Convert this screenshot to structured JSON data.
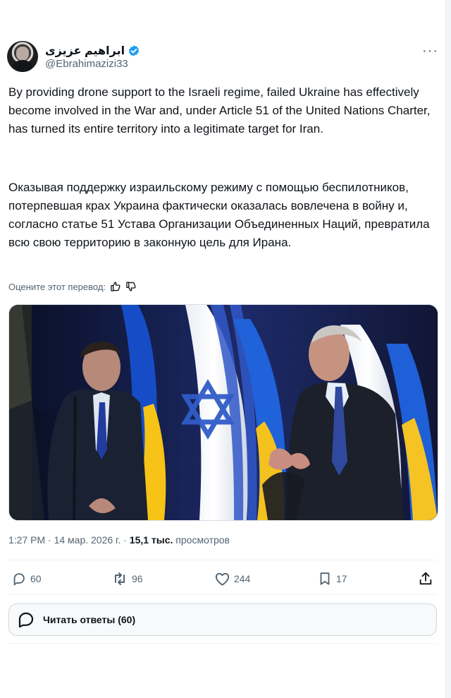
{
  "tweet": {
    "display_name": "ابراهیم عزیزی",
    "handle": "@Ebrahimazizi33",
    "more_label": "···",
    "text_en": "By providing drone support to the Israeli regime, failed Ukraine has effectively become involved in the War and, under Article 51 of the United Nations Charter, has turned its entire territory into a legitimate target for Iran.",
    "text_ru": "Оказывая поддержку израильскому режиму с помощью беспилотников, потерпевшая крах Украина фактически оказалась вовлечена в войну и, согласно статье 51 Устава Организации Объединенных Наций, превратила всю свою территорию в законную цель для Ирана.",
    "rate_translation_label": "Оцените этот перевод:",
    "timestamp": "1:27 PM · 14 мар. 2026 г. · ",
    "views_count": "15,1 тыс.",
    "views_label": " просмотров",
    "actions": {
      "replies": "60",
      "reposts": "96",
      "likes": "244",
      "bookmarks": "17"
    },
    "read_replies_label": "Читать ответы (60)"
  },
  "colors": {
    "verified": "#1d9bf0",
    "muted": "#536471",
    "text": "#0f1419"
  },
  "icons": [
    "verified-icon",
    "more-icon",
    "thumbs-up-icon",
    "thumbs-down-icon",
    "reply-icon",
    "repost-icon",
    "like-icon",
    "bookmark-icon",
    "share-icon",
    "chat-bubble-icon"
  ]
}
